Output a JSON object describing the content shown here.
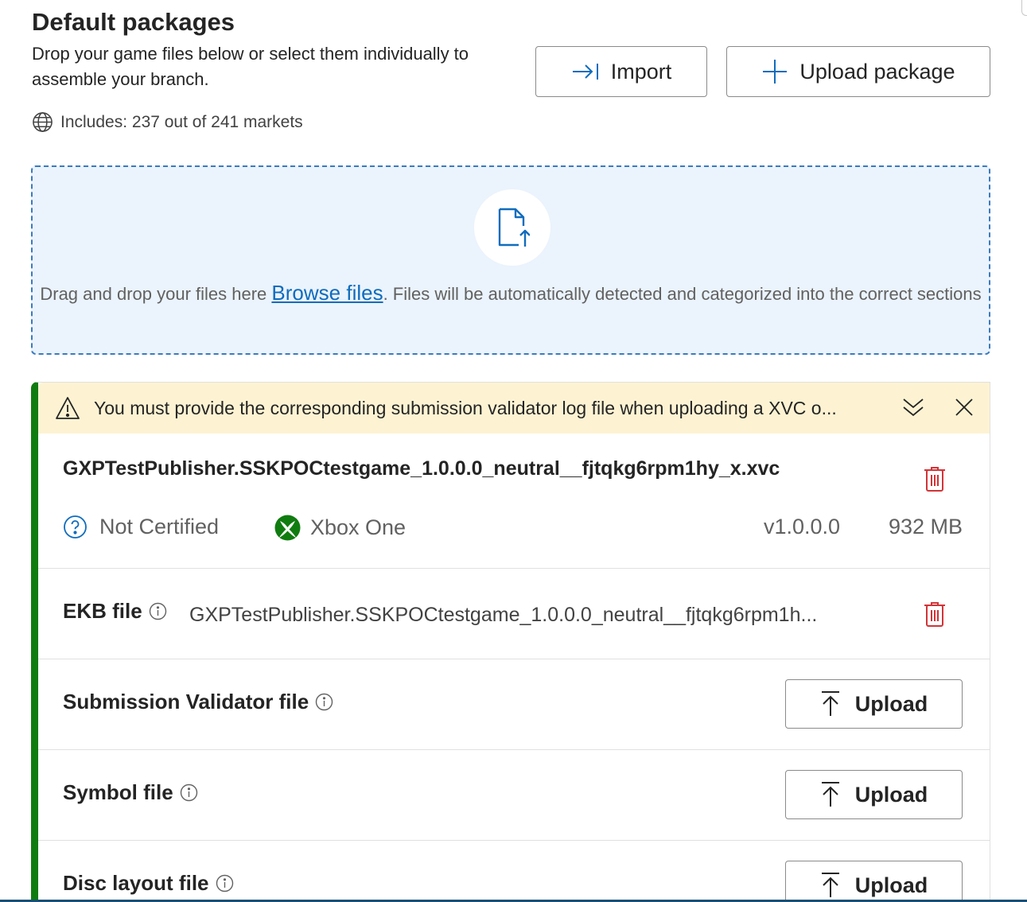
{
  "header": {
    "title": "Default packages",
    "subtitle": "Drop your game files below or select them individually to assemble your branch.",
    "markets": "Includes: 237 out of 241 markets",
    "import_label": "Import",
    "upload_package_label": "Upload package"
  },
  "dropzone": {
    "text_before": "Drag and drop your files here ",
    "browse_link": "Browse files",
    "text_after": ". Files will be automatically detected and categorized into the correct sections"
  },
  "package": {
    "warning": "You must provide the corresponding submission validator log file when uploading a XVC o...",
    "name": "GXPTestPublisher.SSKPOCtestgame_1.0.0.0_neutral__fjtqkg6rpm1hy_x.xvc",
    "certification": "Not Certified",
    "platform": "Xbox One",
    "version": "v1.0.0.0",
    "size": "932 MB",
    "ekb_label": "EKB file",
    "ekb_value": "GXPTestPublisher.SSKPOCtestgame_1.0.0.0_neutral__fjtqkg6rpm1h...",
    "files": [
      {
        "label": "Submission Validator file",
        "action": "Upload"
      },
      {
        "label": "Symbol file",
        "action": "Upload"
      },
      {
        "label": "Disc layout file",
        "action": "Upload"
      }
    ]
  },
  "colors": {
    "accent": "#0f6cbd",
    "success": "#107c10",
    "danger": "#d13438",
    "warning_bg": "#fdf3d3",
    "dropzone_bg": "#ebf3fc"
  }
}
